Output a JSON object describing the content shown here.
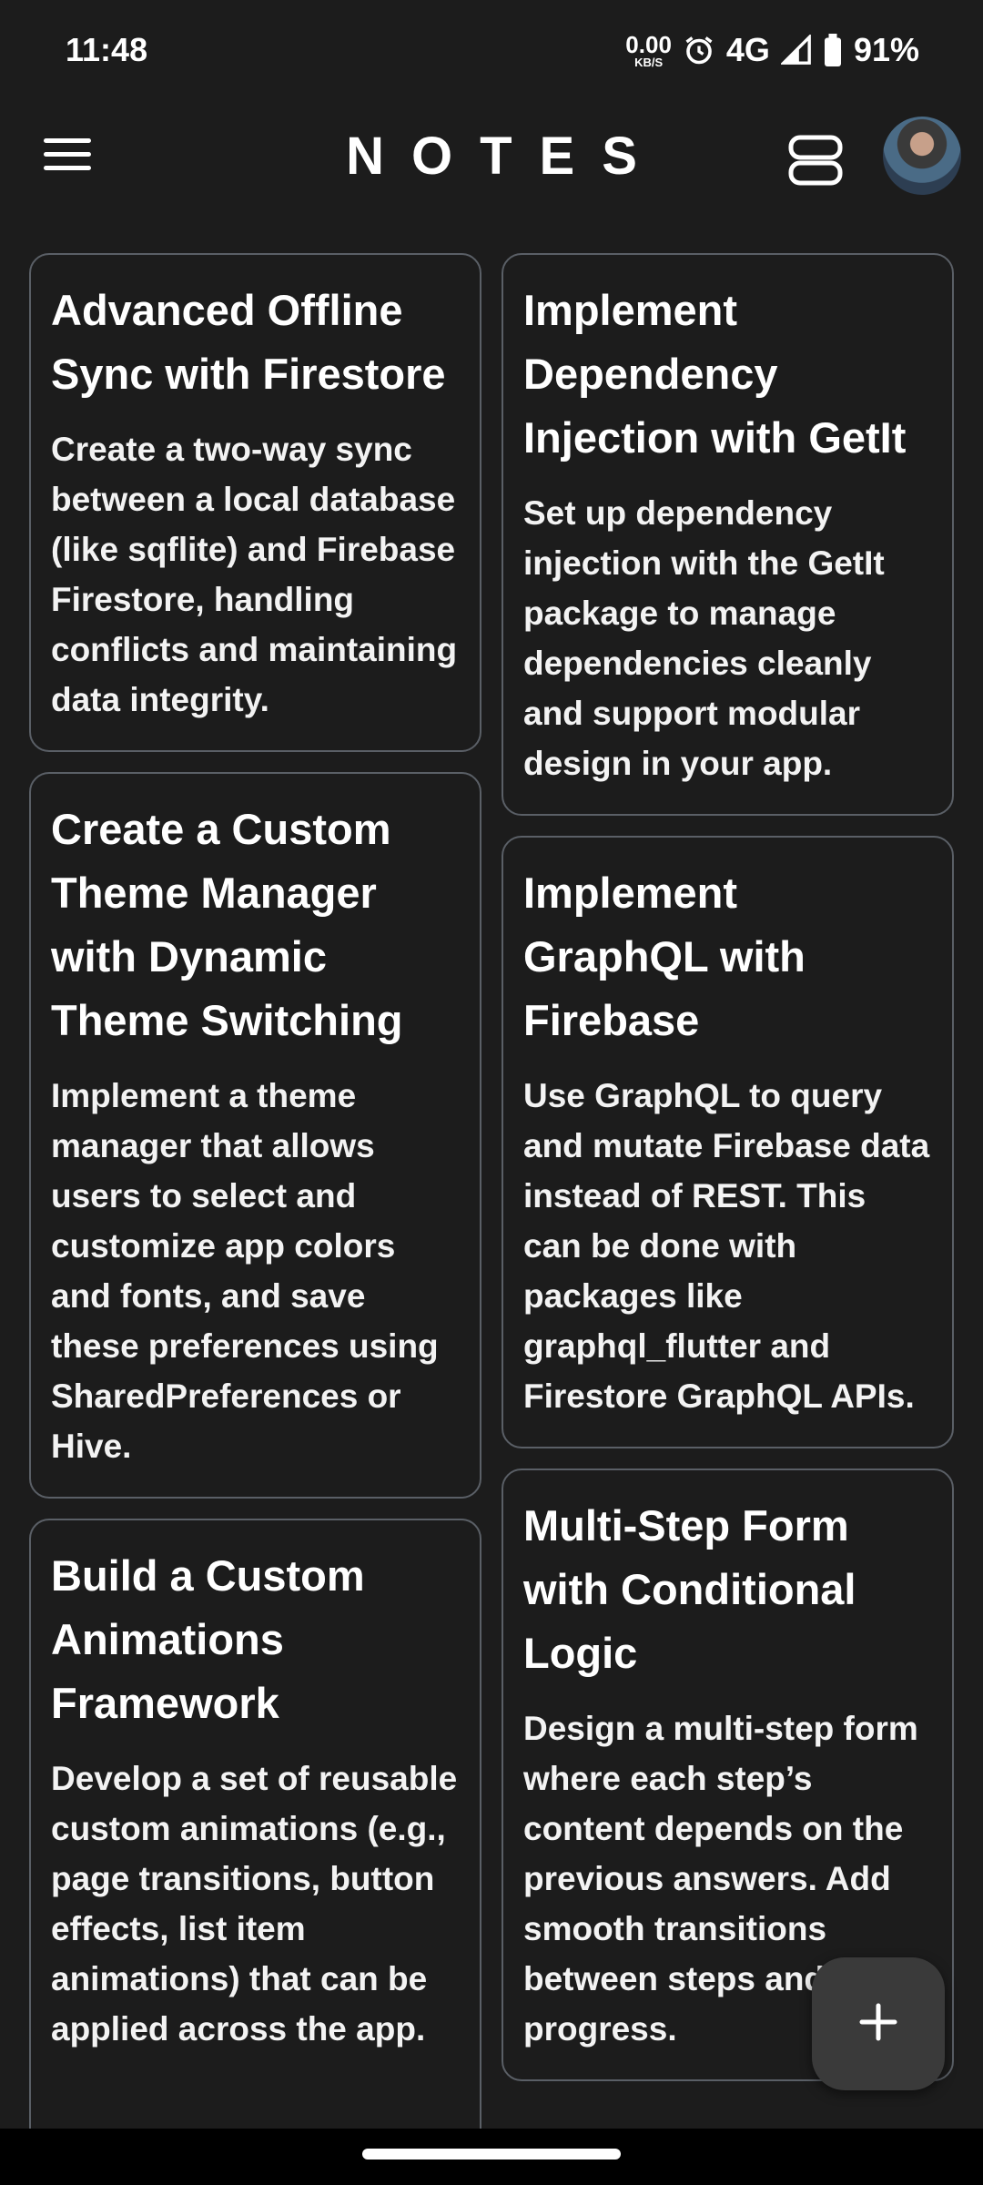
{
  "status_bar": {
    "time": "11:48",
    "net_speed_value": "0.00",
    "net_speed_unit": "KB/S",
    "network": "4G",
    "battery": "91%"
  },
  "app_bar": {
    "title": "NOTES",
    "menu_icon": "hamburger-menu-icon",
    "layout_icon": "view-agenda-icon",
    "avatar": "profile-avatar"
  },
  "notes": {
    "left": [
      {
        "title": "Advanced Offline Sync with Firestore",
        "body": "Create a two-way sync between a local database (like sqflite) and Firebase Firestore, handling conflicts and maintaining data integrity."
      },
      {
        "title": "Create a Custom Theme Manager with Dynamic Theme Switching",
        "body": "Implement a theme manager that allows users to select and customize app colors and fonts, and save these preferences using SharedPreferences or Hive."
      },
      {
        "title": "Build a Custom Animations Framework",
        "body": "Develop a set of reusable custom animations (e.g., page transitions, button effects, list item animations) that can be applied across the app."
      }
    ],
    "right": [
      {
        "title": "Implement Dependency Injection with GetIt",
        "body": "Set up dependency injection with the GetIt package to manage dependencies cleanly and support modular design in your app."
      },
      {
        "title": "Implement GraphQL with Firebase",
        "body": "Use GraphQL to query and mutate Firebase data instead of REST. This can be done with packages like graphql_flutter and Firestore GraphQL APIs."
      },
      {
        "title": "Multi-Step Form with Conditional Logic",
        "body": "Design a multi-step form where each step’s content depends on the previous answers. Add smooth transitions between steps and user progress."
      }
    ]
  },
  "fab": {
    "icon": "add-icon"
  },
  "colors": {
    "background": "#1c1c1c",
    "card_border": "#5a5f66",
    "text": "#ffffff",
    "fab": "#3a3a3a"
  }
}
